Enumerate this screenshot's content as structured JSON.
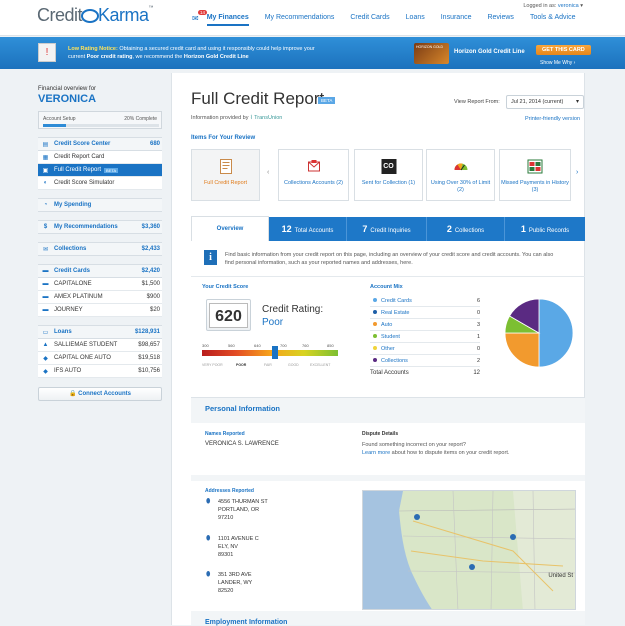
{
  "header": {
    "logo_left": "Credit",
    "logo_right": "Karma",
    "logged_in_label": "Logged in as:",
    "user": "veronica",
    "mail_count": "14",
    "nav": [
      "My Finances",
      "My Recommendations",
      "Credit Cards",
      "Loans",
      "Insurance",
      "Reviews",
      "Tools & Advice"
    ]
  },
  "banner": {
    "notice_title": "Low Rating Notice:",
    "notice_text_1": "Obtaining a secured credit card and using it responsibly could help improve your",
    "notice_text_2a": "current",
    "notice_text_2b": "Poor credit rating",
    "notice_text_2c": ", we recommend the",
    "notice_text_2d": "Horizon Gold Credit Line",
    "card_art_text": "HORIZON GOLD",
    "card_name": "Horizon Gold Credit Line",
    "cta": "GET THIS CARD",
    "why": "Show Me Why ›"
  },
  "sidebar": {
    "overview_label": "Financial overview for",
    "name": "VERONICA",
    "setup_label": "Account Setup",
    "setup_pct_label": "20% Complete",
    "setup_pct": 20,
    "sections": [
      {
        "label": "Credit Score Center",
        "value": "680",
        "icon": "score-icon",
        "items": [
          {
            "label": "Credit Report Card",
            "value": "",
            "icon": "report-card-icon"
          },
          {
            "label": "Full Credit Report",
            "value": "",
            "icon": "document-icon",
            "selected": true,
            "badge": "BETA"
          },
          {
            "label": "Credit Score Simulator",
            "value": "",
            "icon": "simulator-icon"
          }
        ]
      },
      {
        "label": "My Spending",
        "value": "",
        "icon": "pie-icon",
        "items": []
      },
      {
        "label": "My Recommendations",
        "value": "$3,360",
        "icon": "dollar-icon",
        "items": []
      },
      {
        "label": "Collections",
        "value": "$2,433",
        "icon": "collections-icon",
        "items": []
      },
      {
        "label": "Credit Cards",
        "value": "$2,420",
        "icon": "card-icon",
        "items": [
          {
            "label": "CAPITALONE",
            "value": "$1,500",
            "icon": "card-icon"
          },
          {
            "label": "AMEX PLATINUM",
            "value": "$900",
            "icon": "card-icon"
          },
          {
            "label": "JOURNEY",
            "value": "$20",
            "icon": "card-icon"
          }
        ]
      },
      {
        "label": "Loans",
        "value": "$128,931",
        "icon": "loan-icon",
        "items": [
          {
            "label": "SALLIEMAE STUDENT",
            "value": "$98,657",
            "icon": "graduation-cap-icon"
          },
          {
            "label": "CAPITAL ONE AUTO",
            "value": "$19,518",
            "icon": "car-icon"
          },
          {
            "label": "IFS AUTO",
            "value": "$10,756",
            "icon": "car-icon"
          }
        ]
      }
    ],
    "connect": "Connect Accounts"
  },
  "main": {
    "title": "Full Credit Report",
    "beta": "BETA",
    "provided_by": "Information provided by",
    "provider": "TransUnion",
    "view_from_label": "View Report From:",
    "view_from_value": "Jul 21, 2014 (current)",
    "printer_friendly": "Printer-friendly version",
    "items_title": "Items For Your Review",
    "review_items": [
      {
        "label": "Full Credit Report",
        "icon": "document-icon"
      },
      {
        "label": "Collections Accounts (2)",
        "icon": "collections-icon"
      },
      {
        "label": "Sent for Collection (1)",
        "icon": "co-icon"
      },
      {
        "label": "Using Over 30% of Limit (2)",
        "icon": "gauge-icon"
      },
      {
        "label": "Missed Payments in History (3)",
        "icon": "calendar-icon"
      }
    ],
    "co_text": "CO",
    "tabs": [
      {
        "count": "",
        "label": "Overview"
      },
      {
        "count": "12",
        "label": "Total Accounts"
      },
      {
        "count": "7",
        "label": "Credit Inquiries"
      },
      {
        "count": "2",
        "label": "Collections"
      },
      {
        "count": "1",
        "label": "Public Records"
      }
    ],
    "info_icon": "i",
    "info_text": "Find basic information from your credit report on this page, including an overview of your credit score and credit accounts. You can also find personal information, such as your reported names and addresses, here.",
    "score_title": "Your Credit Score",
    "score": "620",
    "rating_label": "Credit Rating:",
    "rating": "Poor",
    "scale_ticks": [
      "300",
      "560",
      "640",
      "700",
      "760",
      "850"
    ],
    "scale_labels": [
      "VERY POOR",
      "POOR",
      "FAIR",
      "GOOD",
      "EXCELLENT"
    ],
    "mix_title": "Account Mix",
    "mix": [
      {
        "label": "Credit Cards",
        "count": "6",
        "value": 6,
        "color": "#5aa8e6"
      },
      {
        "label": "Real Estate",
        "count": "0",
        "value": 0,
        "color": "#1e5fa8"
      },
      {
        "label": "Auto",
        "count": "3",
        "value": 3,
        "color": "#f29a2e"
      },
      {
        "label": "Student",
        "count": "1",
        "value": 1,
        "color": "#7cbf32"
      },
      {
        "label": "Other",
        "count": "0",
        "value": 0,
        "color": "#f0d43a"
      },
      {
        "label": "Collections",
        "count": "2",
        "value": 2,
        "color": "#5a2a82"
      }
    ],
    "total_label": "Total Accounts",
    "total": "12",
    "personal_title": "Personal Information",
    "names_label": "Names Reported",
    "name_value": "VERONICA S. LAWRENCE",
    "dispute_label": "Dispute Details",
    "dispute_q": "Found something incorrect on your report?",
    "dispute_link": "Learn more",
    "dispute_rest": "about how to dispute items on your credit report.",
    "addresses_label": "Addresses Reported",
    "addresses": [
      [
        "4556 THURMAN ST",
        "PORTLAND, OR",
        "97210"
      ],
      [
        "1101 AVENUE C",
        "ELY, NV",
        "89301"
      ],
      [
        "351 3RD AVE",
        "LANDER, WY",
        "82520"
      ]
    ],
    "map_label": "United St",
    "employment_title": "Employment Information"
  }
}
